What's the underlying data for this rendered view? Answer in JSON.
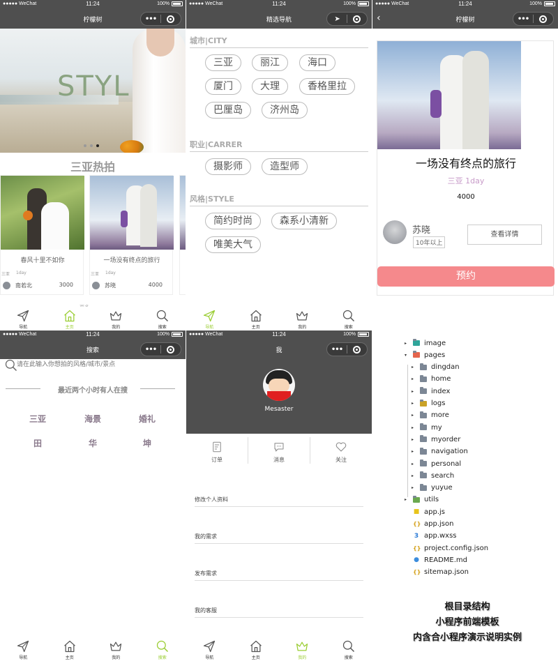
{
  "status": {
    "carrier": "●●●●● WeChat",
    "time": "11:24",
    "battery": "100%"
  },
  "capsule": {
    "dots": "•••"
  },
  "p1": {
    "title": "柠檬树",
    "banner_text": "STYLE",
    "section_title": "三亚热拍",
    "cards": [
      {
        "caption": "春风十里不如你",
        "city": "三亚",
        "duration": "1day",
        "name": "南若北",
        "price": "3000"
      },
      {
        "caption": "一场没有终点的旅行",
        "city": "三亚",
        "duration": "1day",
        "name": "苏晓",
        "price": "4000"
      }
    ],
    "peek_text": "更多"
  },
  "p2": {
    "title": "精选导航",
    "city_header": "城市|CITY",
    "cities": [
      "三亚",
      "丽江",
      "海口",
      "厦门",
      "大理",
      "香格里拉",
      "巴厘岛",
      "济州岛"
    ],
    "job_header": "职业|CARRER",
    "jobs": [
      "摄影师",
      "造型师"
    ],
    "style_header": "风格|STYLE",
    "styles": [
      "简约时尚",
      "森系小清新",
      "唯美大气"
    ]
  },
  "p3": {
    "title": "柠檬树",
    "back": "‹",
    "trip_title": "一场没有终点的旅行",
    "location_day": "三亚 1day",
    "price": "4000",
    "photographer": "苏晓",
    "experience": "10年以上",
    "detail_button": "查看详情",
    "book_button": "预约"
  },
  "p4": {
    "title": "搜索",
    "search_placeholder": "请在此输入你想拍的风格/城市/景点",
    "hot_title": "最近两个小时有人在搜",
    "hot": [
      "三亚",
      "海景",
      "婚礼",
      "田",
      "华",
      "坤"
    ]
  },
  "p5": {
    "title": "我",
    "username": "Mesaster",
    "actions": [
      "订单",
      "消息",
      "关注"
    ],
    "menu": [
      "修改个人资料",
      "我的需求",
      "发布需求",
      "我的客服"
    ]
  },
  "tabs": [
    "导航",
    "主页",
    "我的",
    "搜索"
  ],
  "tree": {
    "items": [
      {
        "label": "image",
        "kind": "folder-image",
        "level": 0,
        "arrow": "▸"
      },
      {
        "label": "pages",
        "kind": "folder-pages",
        "level": 0,
        "arrow": "▾"
      },
      {
        "label": "dingdan",
        "kind": "folder",
        "level": 1,
        "arrow": "▸"
      },
      {
        "label": "home",
        "kind": "folder",
        "level": 1,
        "arrow": "▸"
      },
      {
        "label": "index",
        "kind": "folder",
        "level": 1,
        "arrow": "▸"
      },
      {
        "label": "logs",
        "kind": "folder-logs",
        "level": 1,
        "arrow": "▸"
      },
      {
        "label": "more",
        "kind": "folder",
        "level": 1,
        "arrow": "▸"
      },
      {
        "label": "my",
        "kind": "folder",
        "level": 1,
        "arrow": "▸"
      },
      {
        "label": "myorder",
        "kind": "folder",
        "level": 1,
        "arrow": "▸"
      },
      {
        "label": "navigation",
        "kind": "folder",
        "level": 1,
        "arrow": "▸"
      },
      {
        "label": "personal",
        "kind": "folder",
        "level": 1,
        "arrow": "▸"
      },
      {
        "label": "search",
        "kind": "folder",
        "level": 1,
        "arrow": "▸"
      },
      {
        "label": "yuyue",
        "kind": "folder",
        "level": 1,
        "arrow": "▸"
      },
      {
        "label": "utils",
        "kind": "folder-utils",
        "level": 0,
        "arrow": "▸"
      },
      {
        "label": "app.js",
        "kind": "js",
        "level": 0,
        "arrow": ""
      },
      {
        "label": "app.json",
        "kind": "json",
        "level": 0,
        "arrow": ""
      },
      {
        "label": "app.wxss",
        "kind": "wxss",
        "level": 0,
        "arrow": ""
      },
      {
        "label": "project.config.json",
        "kind": "json",
        "level": 0,
        "arrow": ""
      },
      {
        "label": "README.md",
        "kind": "md",
        "level": 0,
        "arrow": ""
      },
      {
        "label": "sitemap.json",
        "kind": "json",
        "level": 0,
        "arrow": ""
      }
    ]
  },
  "caption": [
    "根目录结构",
    "小程序前端模板",
    "内含合小程序演示说明实例"
  ],
  "colors": {
    "bar": "#4f4f4f",
    "accent": "#9acd32",
    "pink": "#f5898c",
    "lavender": "#c79ac8"
  }
}
